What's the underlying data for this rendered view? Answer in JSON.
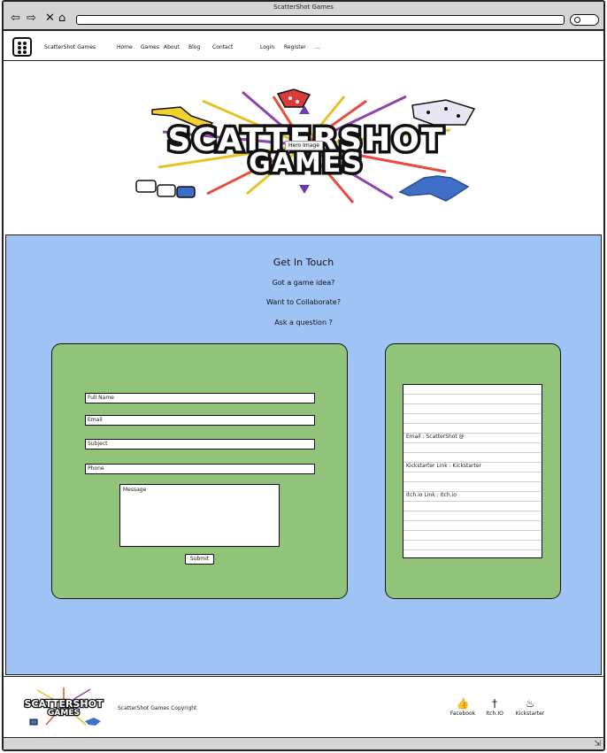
{
  "window": {
    "title": "ScatterShot Games"
  },
  "browser": {
    "back_icon": "arrow-left-icon",
    "forward_icon": "arrow-right-icon",
    "close_icon": "close-icon",
    "home_icon": "home-icon",
    "url": "",
    "search_icon": "search-icon"
  },
  "nav": {
    "brand": "ScatterShot Games",
    "links": [
      "Home",
      "Games",
      "About",
      "Blog",
      "Contact"
    ],
    "login": "Login",
    "register": "Register",
    "more": "..."
  },
  "hero": {
    "label": "Hero Image",
    "logo_line1": "SCATTERSHOT",
    "logo_line2": "GAMES"
  },
  "contact": {
    "heading": "Get In Touch",
    "lines": [
      "Got a game idea?",
      "Want to Collaborate?",
      "Ask a question ?"
    ],
    "form": {
      "full_name": "Full Name",
      "email": "Email",
      "subject": "Subject",
      "phone": "Phone",
      "message": "Message",
      "submit": "Submit"
    },
    "info": {
      "email": "Email : ScatterShot @",
      "kickstarter": "Kickstarter Link : Kickstarter",
      "itchio": "Itch.io Link : Itch.io"
    }
  },
  "footer": {
    "logo_line1": "SCATTERSHOT",
    "logo_line2": "GAMES",
    "copyright": "ScatterShot Games Copyright",
    "social": [
      {
        "label": "Facebook",
        "icon": "thumbs-up-icon",
        "glyph": "👍"
      },
      {
        "label": "Itch.IO",
        "icon": "sword-icon",
        "glyph": "†"
      },
      {
        "label": "Kickstarter",
        "icon": "flame-icon",
        "glyph": "♨"
      }
    ]
  },
  "colors": {
    "contact_bg": "#9fc3f5",
    "panel_bg": "#92c37b",
    "chrome_bg": "#d4d4d4"
  }
}
